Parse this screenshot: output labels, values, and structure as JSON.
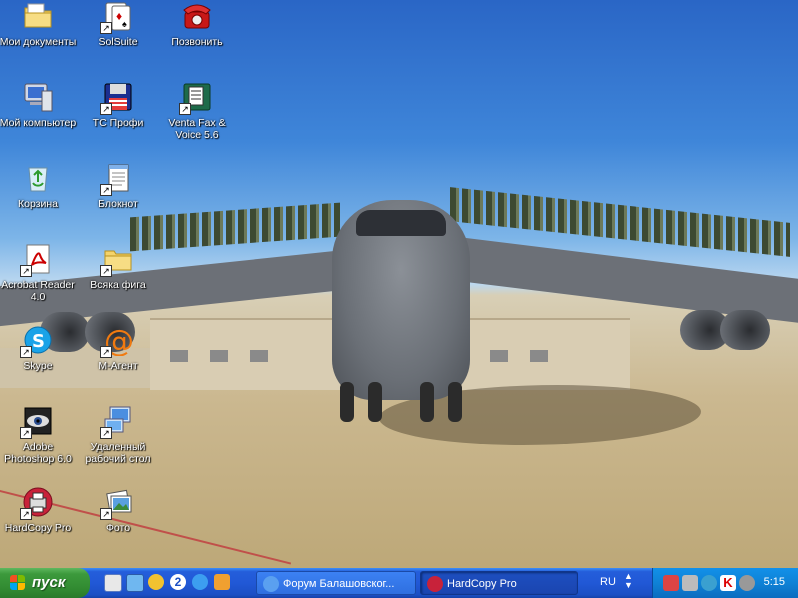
{
  "desktop": {
    "icons": [
      {
        "label": "Мои документы"
      },
      {
        "label": "SolSuite"
      },
      {
        "label": "Позвонить"
      },
      {
        "label": "Мой компьютер"
      },
      {
        "label": "TC Профи"
      },
      {
        "label": "Venta Fax & Voice 5.6"
      },
      {
        "label": "Корзина"
      },
      {
        "label": "Блокнот"
      },
      {
        "label": "Acrobat Reader 4.0"
      },
      {
        "label": "Всяка фига"
      },
      {
        "label": "Skype"
      },
      {
        "label": "M-Агент"
      },
      {
        "label": "Adobe Photoshop 6.0"
      },
      {
        "label": "Удаленный рабочий стол"
      },
      {
        "label": "HardCopy Pro"
      },
      {
        "label": "Фото"
      }
    ]
  },
  "taskbar": {
    "start_label": "пуск",
    "tasks": [
      {
        "label": "Форум Балашовског..."
      },
      {
        "label": "HardCopy Pro"
      }
    ],
    "language": "RU",
    "clock": "5:15"
  },
  "colors": {
    "taskbar": "#245edb",
    "start": "#3c9a3c",
    "tray": "#0f82d6"
  }
}
